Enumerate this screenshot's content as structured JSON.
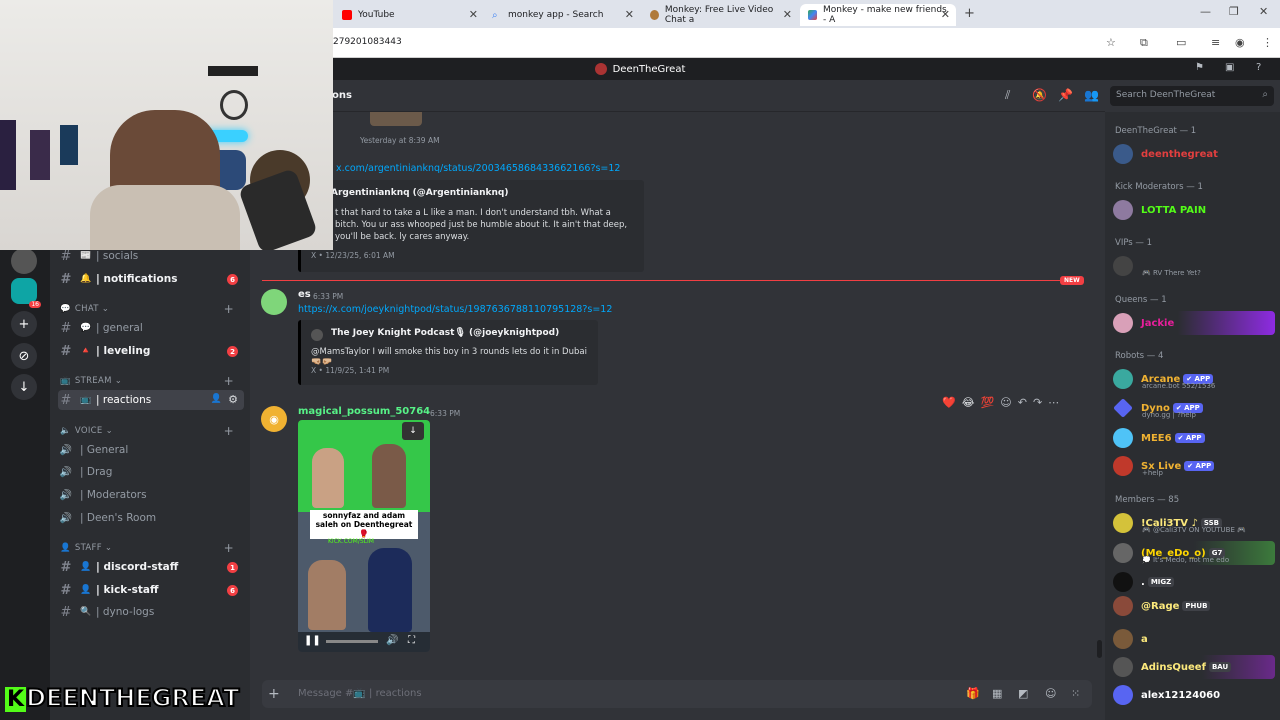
{
  "browser": {
    "tabs": [
      {
        "label": "YouTube",
        "color": "#ff0000"
      },
      {
        "label": "monkey app - Search",
        "color": "#4285f4"
      },
      {
        "label": "Monkey: Free Live Video Chat a",
        "color": "#f4b400"
      },
      {
        "label": "Monkey - make new friends - A",
        "color": "#34a853"
      }
    ],
    "url": "279201083443"
  },
  "discord": {
    "title": "DeenTheGreat",
    "channel_header": "ons",
    "search_placeholder": "Search DeenTheGreat",
    "sidebar": {
      "channels_top": [
        {
          "name": "| socials",
          "emoji": "📰",
          "unread": false
        },
        {
          "name": "| notifications",
          "emoji": "🔔",
          "unread": true,
          "badge": "6"
        }
      ],
      "chat_category": "CHAT",
      "chat_channels": [
        {
          "name": "| general",
          "emoji": "💬",
          "unread": false
        },
        {
          "name": "| leveling",
          "emoji": "🔺",
          "unread": true,
          "badge": "2"
        }
      ],
      "stream_category": "STREAM",
      "stream_channels": [
        {
          "name": "| reactions",
          "emoji": "📺",
          "active": true
        }
      ],
      "voice_category": "VOICE",
      "voice_channels": [
        "| General",
        "| Drag",
        "| Moderators",
        "| Deen's Room"
      ],
      "staff_category": "STAFF",
      "staff_channels": [
        {
          "name": "| discord-staff",
          "emoji": "👤",
          "unread": true,
          "badge": "1"
        },
        {
          "name": "| kick-staff",
          "emoji": "👤",
          "unread": true,
          "badge": "6"
        },
        {
          "name": "| dyno-logs",
          "emoji": "🔍",
          "unread": false
        }
      ],
      "server_badge": "16"
    },
    "messages": {
      "m0_time": "Yesterday at 8:39 AM",
      "m0_link": "x.com/argentinianknq/status/2003465868433662166?s=12",
      "m0_embed_author": "Argentinianknq (@Argentinianknq)",
      "m0_embed_text": "t that hard to take a L like a man. I don't understand tbh. What a bitch. You ur ass whooped just be humble about it. It ain't that deep, you'll be back. ly cares anyway.",
      "m0_embed_footer": "X • 12/23/25, 6:01 AM",
      "new_label": "NEW",
      "m1_user": "es",
      "m1_time": "6:33 PM",
      "m1_link": "https://x.com/joeyknightpod/status/1987636788110795128?s=12",
      "m1_embed_author": "The Joey Knight Podcast🎙 (@joeyknightpod)",
      "m1_embed_text": "@MamsTaylor I will smoke this boy in 3 rounds lets do it in Dubai 🤜🏼🤛🏼",
      "m1_embed_footer": "X • 11/9/25, 1:41 PM",
      "m2_user": "magical_possum_50764",
      "m2_time": "6:33 PM",
      "m2_video_caption": "sonnyfaz and adam saleh on Deenthegreat 🥊",
      "m2_video_tag": "KICK.COM/SLIM"
    },
    "composer_placeholder": "Message #📺 | reactions",
    "members": {
      "groups": [
        {
          "label": "DeenTheGreat — 1",
          "members": [
            {
              "name": "deenthegreat",
              "color": "#e23f3f"
            }
          ]
        },
        {
          "label": "Kick Moderators — 1",
          "members": [
            {
              "name": "LOTTA PAIN",
              "color": "#53fc18"
            }
          ]
        },
        {
          "label": "VIPs — 1",
          "members": [
            {
              "name": "",
              "sub": "🎮 RV There Yet?",
              "color": "#ffffff"
            }
          ]
        },
        {
          "label": "Queens — 1",
          "members": [
            {
              "name": "Jackie",
              "color": "#e91e9c"
            }
          ]
        },
        {
          "label": "Robots — 4",
          "members": [
            {
              "name": "Arcane",
              "sub": "arcane.bot 552/1536",
              "color": "#f0b232",
              "tag": "✔ APP"
            },
            {
              "name": "Dyno",
              "sub": "dyno.gg | ?help",
              "color": "#f0b232",
              "tag": "✔ APP"
            },
            {
              "name": "MEE6",
              "sub": "",
              "color": "#f0b232",
              "tag": "✔ APP"
            },
            {
              "name": "Sx Live",
              "sub": "+help",
              "color": "#f0b232",
              "tag": "✔ APP"
            }
          ]
        },
        {
          "label": "Members — 85",
          "members": [
            {
              "name": "!Cali3TV ♪",
              "sub": "🎮 @Cali3TV ON YOUTUBE 🎮",
              "color": "#fce97c",
              "tag": "SSB"
            },
            {
              "name": "(Me_eDo_o)",
              "sub": "💭 It's Medo, not me edo",
              "color": "#ffd700",
              "tag": "G7"
            },
            {
              "name": ".",
              "sub": "",
              "color": "#ffffff",
              "tag": "MIGZ"
            },
            {
              "name": "@Rage",
              "sub": "",
              "color": "#fce97c",
              "tag": "PHUB"
            },
            {
              "name": "a",
              "sub": "",
              "color": "#fce97c"
            },
            {
              "name": "AdinsQueef",
              "sub": "",
              "color": "#fce97c",
              "tag": "BAU"
            },
            {
              "name": "alex12124060",
              "sub": "",
              "color": "#ffffff"
            }
          ]
        }
      ]
    }
  },
  "overlay": {
    "watermark_k": "K",
    "watermark_text": "DEENTHEGREAT"
  }
}
